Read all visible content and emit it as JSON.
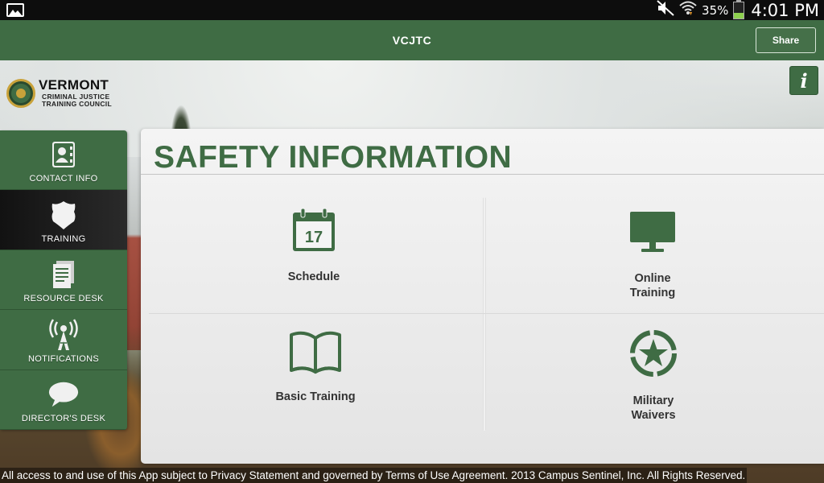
{
  "statusbar": {
    "gallery_icon": "picture-icon",
    "mute_icon": "mute-icon",
    "wifi_icon": "wifi-icon",
    "battery_percent": "35%",
    "battery_level": 0.35,
    "time": "4:01 PM"
  },
  "actionbar": {
    "title": "VCJTC",
    "share_label": "Share"
  },
  "logo": {
    "line1": "VERMONT",
    "line2": "CRIMINAL JUSTICE",
    "line3": "TRAINING COUNCIL"
  },
  "info_button": {
    "label": "i",
    "icon": "info-icon"
  },
  "sidebar": {
    "items": [
      {
        "label": "CONTACT INFO",
        "icon": "address-book-icon",
        "active": false
      },
      {
        "label": "TRAINING",
        "icon": "police-badge-icon",
        "active": true
      },
      {
        "label": "RESOURCE DESK",
        "icon": "document-icon",
        "active": false
      },
      {
        "label": "NOTIFICATIONS",
        "icon": "broadcast-tower-icon",
        "active": false
      },
      {
        "label": "DIRECTOR'S DESK",
        "icon": "speech-bubble-icon",
        "active": false
      }
    ]
  },
  "main": {
    "title": "SAFETY INFORMATION",
    "tiles": [
      {
        "label_lines": [
          "Schedule"
        ],
        "icon": "calendar-icon",
        "calendar_day": "17"
      },
      {
        "label_lines": [
          "Online",
          "Training"
        ],
        "icon": "monitor-icon"
      },
      {
        "label_lines": [
          "Basic Training"
        ],
        "icon": "open-book-icon"
      },
      {
        "label_lines": [
          "Military",
          "Waivers"
        ],
        "icon": "star-emblem-icon"
      }
    ]
  },
  "footer": {
    "text": "All access to and use of this App subject to Privacy Statement and governed by Terms of Use Agreement. 2013 Campus Sentinel, Inc. All Rights Reserved."
  },
  "colors": {
    "brand_green": "#3f6c44",
    "panel_bg": "#ececec",
    "active_nav": "#1a1a1a"
  }
}
